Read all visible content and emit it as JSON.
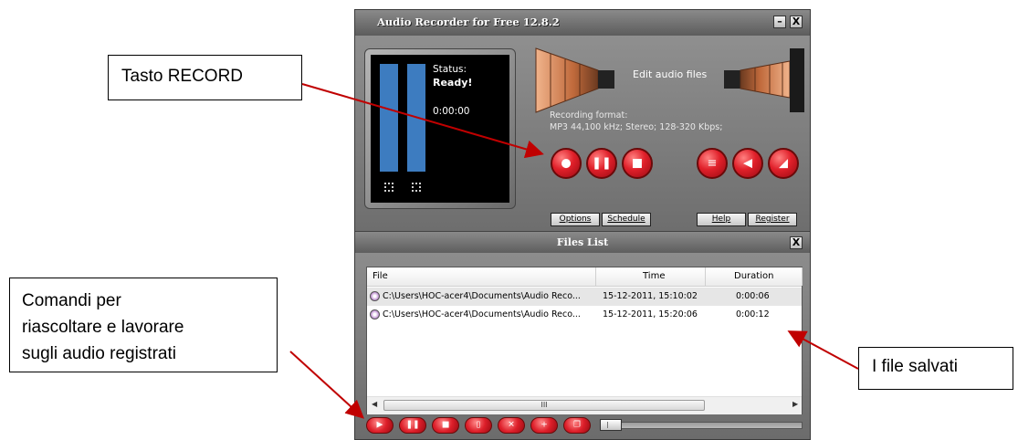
{
  "callouts": {
    "record": "Tasto RECORD",
    "commands_lines": [
      "Comandi per",
      "riascoltare e lavorare",
      "sugli audio registrati"
    ],
    "files": "I file salvati"
  },
  "app": {
    "title": "Audio Recorder for Free 12.8.2",
    "minimize_glyph": "–",
    "close_glyph": "X"
  },
  "recorder": {
    "status_label": "Status:",
    "status_value": "Ready!",
    "elapsed": "0:00:00",
    "edit_label": "Edit audio files",
    "format_label": "Recording format:",
    "format_value": "MP3 44,100 kHz; Stereo;  128-320 Kbps;",
    "buttons": {
      "options": "Options",
      "schedule": "Schedule",
      "help": "Help",
      "register": "Register"
    }
  },
  "files_list": {
    "title": "Files List",
    "close_glyph": "X",
    "columns": [
      "File",
      "Time",
      "Duration"
    ],
    "rows": [
      {
        "file": "C:\\Users\\HOC-acer4\\Documents\\Audio Reco...",
        "time": "15-12-2011, 15:10:02",
        "duration": "0:00:06"
      },
      {
        "file": "C:\\Users\\HOC-acer4\\Documents\\Audio Reco...",
        "time": "15-12-2011, 15:20:06",
        "duration": "0:00:12"
      }
    ],
    "scroll_grip": "III",
    "playback_position": 0.0
  },
  "colors": {
    "accent_red": "#e0202a",
    "meter_blue": "#3d7cc0",
    "arrow_red": "#c00000"
  },
  "icons": {
    "record": "record-icon",
    "pause": "pause-icon",
    "stop": "stop-icon",
    "list": "list-icon",
    "rewind": "rewind-icon",
    "volume": "volume-icon"
  }
}
